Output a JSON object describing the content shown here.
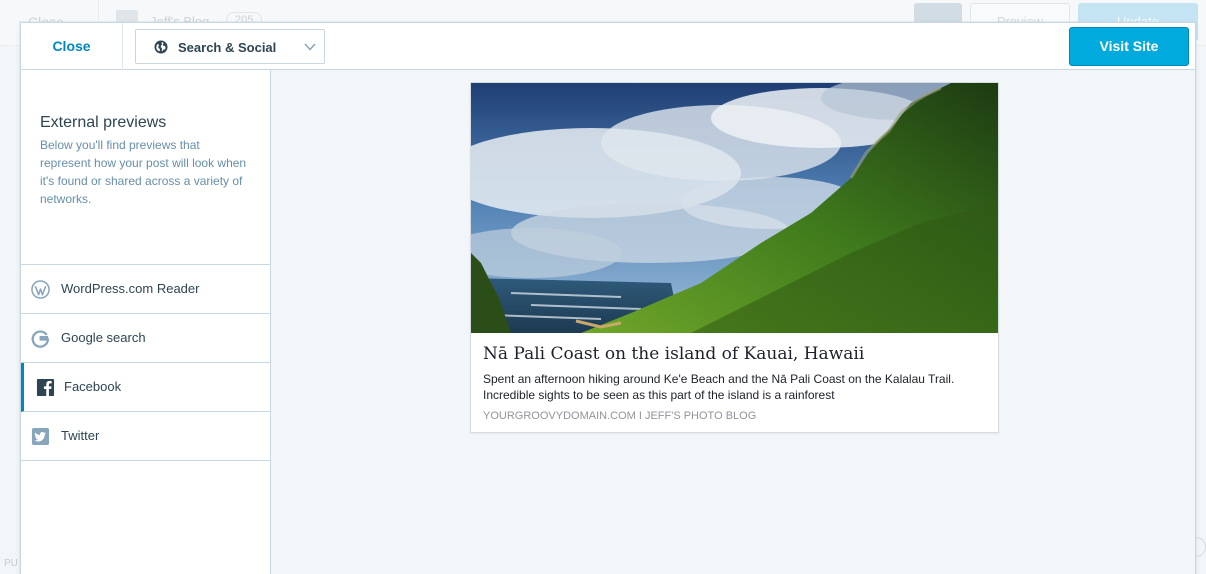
{
  "background": {
    "close_label": "Close",
    "site_name": "Jeff's Blog",
    "post_count": "205",
    "preview_label": "Preview",
    "update_label": "Update",
    "footer_fragment": "PU"
  },
  "topbar": {
    "close_label": "Close",
    "select_label": "Search & Social",
    "visit_label": "Visit Site"
  },
  "sidebar": {
    "title": "External previews",
    "description": "Below you'll find previews that represent how your post will look when it's found or shared across a variety of networks.",
    "items": [
      {
        "label": "WordPress.com Reader",
        "icon": "wordpress-icon"
      },
      {
        "label": "Google search",
        "icon": "google-icon"
      },
      {
        "label": "Facebook",
        "icon": "facebook-icon",
        "active": true
      },
      {
        "label": "Twitter",
        "icon": "twitter-icon"
      }
    ]
  },
  "preview": {
    "title": "Nā Pali Coast on the island of Kauai, Hawaii",
    "description": "Spent an afternoon hiking around Ke'e Beach and the Nā Pali Coast on the Kalalau Trail. Incredible sights to be seen as this part of the island is a rainforest",
    "domain": "YOURGROOVYDOMAIN.COM I JEFF'S PHOTO BLOG"
  },
  "colors": {
    "accent": "#0087be",
    "button_primary": "#00aadc",
    "text_primary": "#2e4453",
    "text_secondary": "#668eaa",
    "background": "#f3f6f8"
  }
}
